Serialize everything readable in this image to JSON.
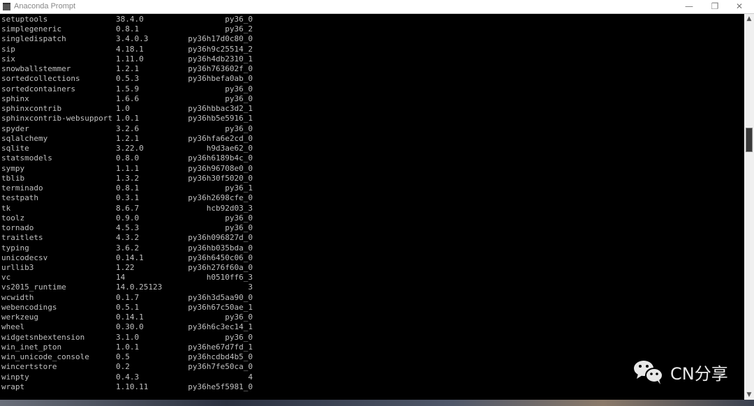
{
  "window": {
    "title": "Anaconda Prompt",
    "minimize_icon": "minimize-icon",
    "maximize_icon": "restore-icon",
    "close_icon": "close-icon"
  },
  "packages": [
    [
      "setuptools",
      "38.4.0",
      "py36_0"
    ],
    [
      "simplegeneric",
      "0.8.1",
      "py36_2"
    ],
    [
      "singledispatch",
      "3.4.0.3",
      "py36h17d0c80_0"
    ],
    [
      "sip",
      "4.18.1",
      "py36h9c25514_2"
    ],
    [
      "six",
      "1.11.0",
      "py36h4db2310_1"
    ],
    [
      "snowballstemmer",
      "1.2.1",
      "py36h763602f_0"
    ],
    [
      "sortedcollections",
      "0.5.3",
      "py36hbefa0ab_0"
    ],
    [
      "sortedcontainers",
      "1.5.9",
      "py36_0"
    ],
    [
      "sphinx",
      "1.6.6",
      "py36_0"
    ],
    [
      "sphinxcontrib",
      "1.0",
      "py36hbbac3d2_1"
    ],
    [
      "sphinxcontrib-websupport",
      "1.0.1",
      "py36hb5e5916_1"
    ],
    [
      "spyder",
      "3.2.6",
      "py36_0"
    ],
    [
      "sqlalchemy",
      "1.2.1",
      "py36hfa6e2cd_0"
    ],
    [
      "sqlite",
      "3.22.0",
      "h9d3ae62_0"
    ],
    [
      "statsmodels",
      "0.8.0",
      "py36h6189b4c_0"
    ],
    [
      "sympy",
      "1.1.1",
      "py36h96708e0_0"
    ],
    [
      "tblib",
      "1.3.2",
      "py36h30f5020_0"
    ],
    [
      "terminado",
      "0.8.1",
      "py36_1"
    ],
    [
      "testpath",
      "0.3.1",
      "py36h2698cfe_0"
    ],
    [
      "tk",
      "8.6.7",
      "hcb92d03_3"
    ],
    [
      "toolz",
      "0.9.0",
      "py36_0"
    ],
    [
      "tornado",
      "4.5.3",
      "py36_0"
    ],
    [
      "traitlets",
      "4.3.2",
      "py36h096827d_0"
    ],
    [
      "typing",
      "3.6.2",
      "py36hb035bda_0"
    ],
    [
      "unicodecsv",
      "0.14.1",
      "py36h6450c06_0"
    ],
    [
      "urllib3",
      "1.22",
      "py36h276f60a_0"
    ],
    [
      "vc",
      "14",
      "h0510ff6_3"
    ],
    [
      "vs2015_runtime",
      "14.0.25123",
      "3"
    ],
    [
      "wcwidth",
      "0.1.7",
      "py36h3d5aa90_0"
    ],
    [
      "webencodings",
      "0.5.1",
      "py36h67c50ae_1"
    ],
    [
      "werkzeug",
      "0.14.1",
      "py36_0"
    ],
    [
      "wheel",
      "0.30.0",
      "py36h6c3ec14_1"
    ],
    [
      "widgetsnbextension",
      "3.1.0",
      "py36_0"
    ],
    [
      "win_inet_pton",
      "1.0.1",
      "py36he67d7fd_1"
    ],
    [
      "win_unicode_console",
      "0.5",
      "py36hcdbd4b5_0"
    ],
    [
      "wincertstore",
      "0.2",
      "py36h7fe50ca_0"
    ],
    [
      "winpty",
      "0.4.3",
      "4"
    ],
    [
      "wrapt",
      "1.10.11",
      "py36he5f5981_0"
    ]
  ],
  "watermark": {
    "text": "CN分享",
    "icon": "wechat-icon"
  },
  "colors": {
    "terminal_bg": "#000000",
    "terminal_fg": "#c0c0c0"
  }
}
